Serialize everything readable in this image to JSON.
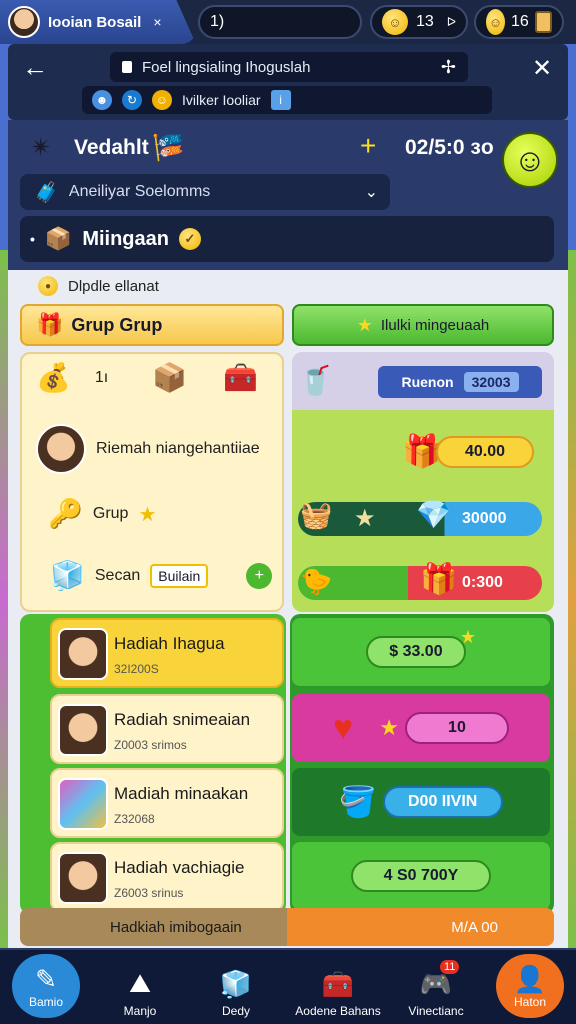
{
  "top": {
    "tab_title": "Iooian Bosail",
    "tab_close": "×",
    "center_pill": "1)",
    "coin_value_1": "13",
    "coin_value_2": "16",
    "coin_glyph": "☺",
    "arrow_glyph": "ᐅ"
  },
  "nav": {
    "back": "←",
    "url": "Foel lingsialing Ihoguslah",
    "close": "✕",
    "sub": "Ivilker Iooliar"
  },
  "header": {
    "title": "Vedahlt",
    "timer": "02/5:0 ɜo",
    "dropdown": "Aneiliyar Soelomms",
    "section": "Miingaan"
  },
  "caption": "Dlpdle ellanat",
  "buttons": {
    "yellow": "Grup Grup",
    "green": "Ilulki mingeuaah"
  },
  "left_card": {
    "row1_label": "1ı",
    "row2_label": "Riemah niangehantiiae",
    "row3_label": "Grup",
    "row4_label": "Secan",
    "row4_chip": "Builain"
  },
  "right_card": {
    "lav_label": "Ruenon",
    "lav_value": "32003",
    "lime_1": "40.00",
    "lime_2": "30000",
    "lime_3": "0:300"
  },
  "quests": [
    {
      "title": "Hadiah Ihagua",
      "sub": "32I200S"
    },
    {
      "title": "Radiah snimeaian",
      "sub": "Z0003 srimos"
    },
    {
      "title": "Madiah minaakan",
      "sub": "Z32068"
    },
    {
      "title": "Hadiah vachiagie",
      "sub": "Z6003 srinus"
    }
  ],
  "rewards": {
    "r1": "$ 33.00",
    "r2": "10",
    "r3": "D00 IIVIN",
    "r4": "4 S0 700Y",
    "strip_left": "Hadkiah imibogaain",
    "strip_right": "M/A 00"
  },
  "bottom_nav": [
    {
      "label": "Bamio"
    },
    {
      "label": "Manjo"
    },
    {
      "label": "Dedy"
    },
    {
      "label": "Aodene Bahans"
    },
    {
      "label": "Vinectianc",
      "badge": "11"
    },
    {
      "label": "Haton"
    }
  ],
  "colors": {
    "accent_blue": "#2a8ad8",
    "accent_orange": "#f07020",
    "green": "#4dbd32"
  }
}
